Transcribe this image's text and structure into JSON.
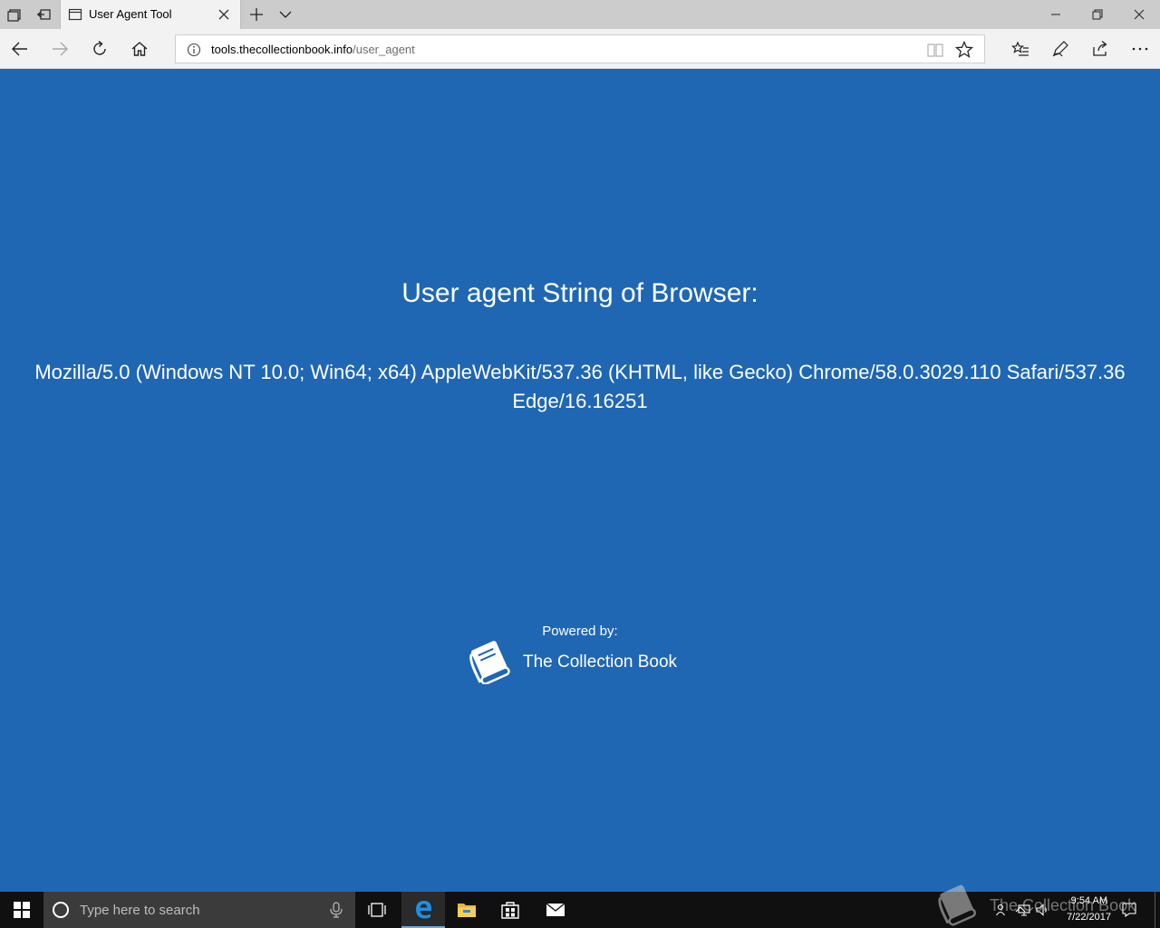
{
  "browser": {
    "tab": {
      "title": "User Agent Tool"
    },
    "address": {
      "host": "tools.thecollectionbook.info",
      "path": "/user_agent"
    }
  },
  "page": {
    "heading": "User agent String of Browser:",
    "user_agent": "Mozilla/5.0 (Windows NT 10.0; Win64; x64) AppleWebKit/537.36 (KHTML, like Gecko) Chrome/58.0.3029.110 Safari/537.36 Edge/16.16251",
    "powered_label": "Powered by:",
    "brand_name": "The Collection Book",
    "background_color": "#1f67b3"
  },
  "taskbar": {
    "search_placeholder": "Type here to search",
    "apps": [
      "edge-icon",
      "file-explorer-icon",
      "store-icon",
      "mail-icon"
    ],
    "clock": {
      "time": "9:54 AM",
      "date": "7/22/2017"
    },
    "watermark": "The Collection Book"
  }
}
